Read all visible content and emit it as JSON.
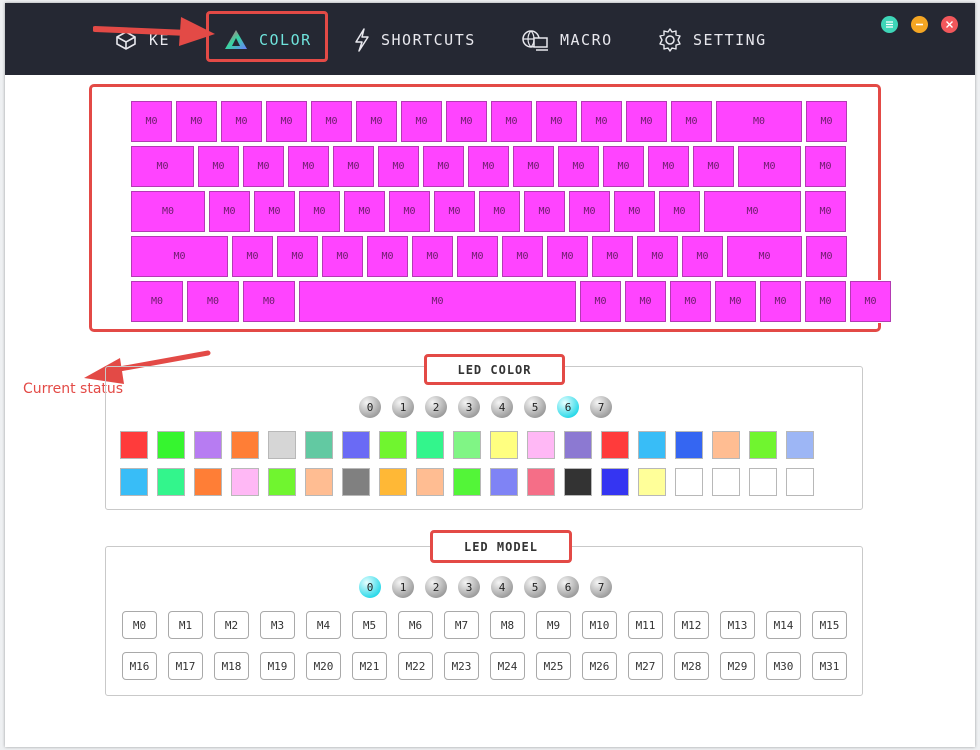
{
  "nav": {
    "items": [
      {
        "label": "KEYS",
        "icon": "keycap-icon"
      },
      {
        "label": "COLOR",
        "icon": "color-prism-icon"
      },
      {
        "label": "SHORTCUTS",
        "icon": "lightning-icon"
      },
      {
        "label": "MACRO",
        "icon": "macro-monitor-icon"
      },
      {
        "label": "SETTING",
        "icon": "gear-icon"
      }
    ],
    "visible_keys_label": "KE",
    "active": "COLOR"
  },
  "window_controls": [
    "menu-icon",
    "minimize-icon",
    "close-icon"
  ],
  "keyboard": {
    "key_label": "M0",
    "key_color": "#ff44ff",
    "rows": [
      {
        "keys": [
          "M0",
          "M0",
          "M0",
          "M0",
          "M0",
          "M0",
          "M0",
          "M0",
          "M0",
          "M0",
          "M0",
          "M0",
          "M0",
          "M0",
          "M0"
        ]
      },
      {
        "keys": [
          "M0",
          "M0",
          "M0",
          "M0",
          "M0",
          "M0",
          "M0",
          "M0",
          "M0",
          "M0",
          "M0",
          "M0",
          "M0",
          "M0",
          "M0"
        ]
      },
      {
        "keys": [
          "M0",
          "M0",
          "M0",
          "M0",
          "M0",
          "M0",
          "M0",
          "M0",
          "M0",
          "M0",
          "M0",
          "M0",
          "M0",
          "M0"
        ]
      },
      {
        "keys": [
          "M0",
          "M0",
          "M0",
          "M0",
          "M0",
          "M0",
          "M0",
          "M0",
          "M0",
          "M0",
          "M0",
          "M0",
          "M0",
          "M0"
        ]
      },
      {
        "keys": [
          "M0",
          "M0",
          "M0",
          "M0",
          "M0",
          "M0",
          "M0",
          "M0",
          "M0",
          "M0",
          "M0"
        ]
      }
    ]
  },
  "annotation": {
    "note": "Current status"
  },
  "led_color": {
    "title": "LED COLOR",
    "layers": [
      "0",
      "1",
      "2",
      "3",
      "4",
      "5",
      "6",
      "7"
    ],
    "active_layer": "6",
    "swatches": [
      "#ff3b3b",
      "#36f52f",
      "#b77cf2",
      "#ff7e36",
      "#d6d6d6",
      "#62c9a2",
      "#6a6af5",
      "#70f52f",
      "#33f58c",
      "#80f585",
      "#ffff80",
      "#ffb8f5",
      "#8c79d2",
      "#ff3b3b",
      "#38bdf7",
      "#3566f2",
      "#ffbd92",
      "#70f52f",
      "#9db6f5",
      "#38bdf7",
      "#33f58c",
      "#ff7e36",
      "#ffb8f5",
      "#70f52f",
      "#ffbd92",
      "#808080",
      "#ffb836",
      "#ffbd92",
      "#53f538",
      "#7f83f5",
      "#f56e87",
      "#333333",
      "#3535f2",
      "#ffff99",
      "#ffffff",
      "#ffffff",
      "#ffffff",
      "#ffffff"
    ]
  },
  "led_model": {
    "title": "LED MODEL",
    "layers": [
      "0",
      "1",
      "2",
      "3",
      "4",
      "5",
      "6",
      "7"
    ],
    "active_layer": "0",
    "modes": [
      "M0",
      "M1",
      "M2",
      "M3",
      "M4",
      "M5",
      "M6",
      "M7",
      "M8",
      "M9",
      "M10",
      "M11",
      "M12",
      "M13",
      "M14",
      "M15",
      "M16",
      "M17",
      "M18",
      "M19",
      "M20",
      "M21",
      "M22",
      "M23",
      "M24",
      "M25",
      "M26",
      "M27",
      "M28",
      "M29",
      "M30",
      "M31"
    ]
  }
}
